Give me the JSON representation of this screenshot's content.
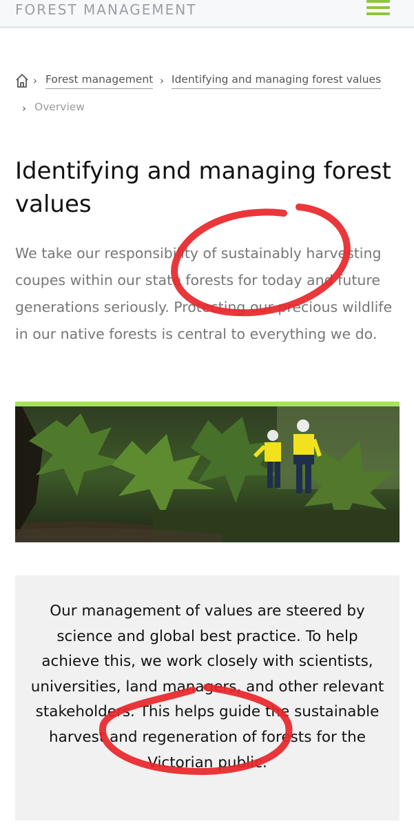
{
  "header": {
    "brand": "FOREST MANAGEMENT",
    "menu_icon": "hamburger-menu-icon",
    "accent_color": "#8fc440"
  },
  "breadcrumb": {
    "home_icon": "home-icon",
    "items": [
      "Forest management",
      "Identifying and managing forest values"
    ],
    "current": "Overview"
  },
  "page": {
    "title_line1": "Identifying and managing forest",
    "title_line2": "values",
    "intro": "We take our responsibility of sustainably harvesting coupes within our state forests for today and future generations seriously. Protecting our precious wildlife in our native forests is central to everything we do."
  },
  "hero": {
    "divider_color": "#a6e35a"
  },
  "callout": {
    "text": "Our management of values are steered by science and global best practice. To help achieve this, we work closely with scientists, universities, land managers, and other relevant stakeholders. This helps guide the sustainable harvest and regeneration of forests for the Victorian public."
  },
  "annotation_color": "#e8262a"
}
